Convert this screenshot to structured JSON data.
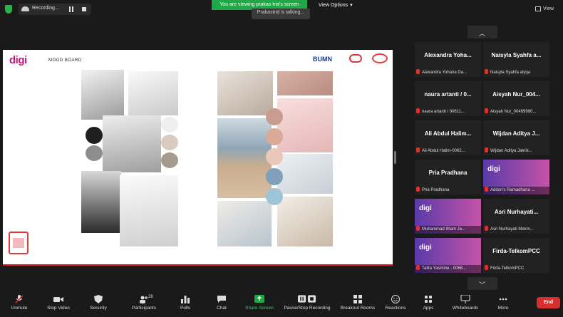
{
  "topbar": {
    "recording_label": "Recording...",
    "viewing_banner": "You are viewing prakas tria's screen",
    "talking": "Prakastrid is talking...",
    "view_options": "View Options",
    "view_right": "View"
  },
  "share": {
    "logo": "digi",
    "mood_title": "MOOD BOARD",
    "bumn": "BUMN"
  },
  "participants": [
    {
      "name": "Alexandra Yoha...",
      "foot": "Alexandra Yohana Da..."
    },
    {
      "name": "Naisyla Syahfa a...",
      "foot": "Naisyla Syahfa alyqa"
    },
    {
      "name": "naura artanti / 0...",
      "foot": "naura artanti / 00611..."
    },
    {
      "name": "Aisyah Nur_004...",
      "foot": "Aisyah Nur_00469980..."
    },
    {
      "name": "Ali Abdul Halim...",
      "foot": "Ali Abdul Halim-0062..."
    },
    {
      "name": "Wijdan Aditya J...",
      "foot": "Wijdan Aditya Jatnik..."
    },
    {
      "name": "Pria Pradhana",
      "foot": "Pria Pradhana"
    },
    {
      "name": "",
      "foot": "Addon's Ramadhana ..."
    },
    {
      "name": "",
      "foot": "Muhammad Ilham Ja..."
    },
    {
      "name": "Asri Nurhayati...",
      "foot": "Asri Nurhayati Mekm..."
    },
    {
      "name": "",
      "foot": "Talita Yasmine - 0068..."
    },
    {
      "name": "Firda-TelkomPCC",
      "foot": "Firda-TelkomPCC"
    }
  ],
  "toolbar": {
    "unmute": "Unmute",
    "stop_video": "Stop Video",
    "security": "Security",
    "participants": "Participants",
    "participants_count": "28",
    "polls": "Polls",
    "chat": "Chat",
    "share_screen": "Share Screen",
    "pause_recording": "Pause/Stop Recording",
    "breakout": "Breakout Rooms",
    "reactions": "Reactions",
    "apps": "Apps",
    "whiteboards": "Whiteboards",
    "more": "More",
    "end": "End"
  },
  "colors": {
    "accent_green": "#1fa845",
    "end_red": "#d72e2e",
    "brand_magenta": "#c2187a"
  }
}
